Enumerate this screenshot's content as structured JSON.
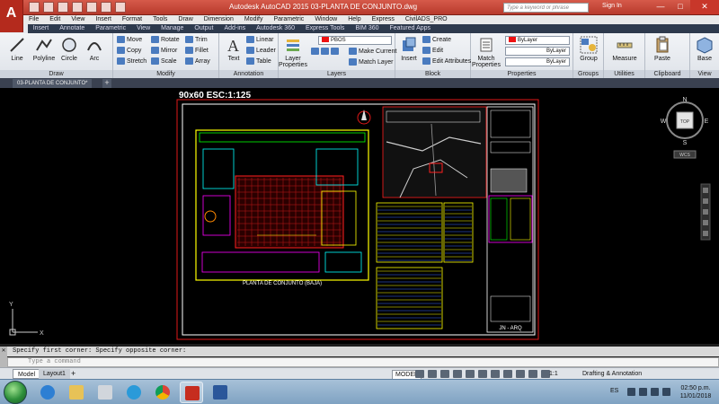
{
  "app": {
    "logo_letter": "A",
    "window_title": "Autodesk AutoCAD 2015     03-PLANTA DE CONJUNTO.dwg",
    "search_placeholder": "Type a keyword or phrase",
    "signin_label": "Sign In",
    "win_min": "—",
    "win_max": "□",
    "win_close": "✕"
  },
  "menubar": [
    "File",
    "Edit",
    "View",
    "Insert",
    "Format",
    "Tools",
    "Draw",
    "Dimension",
    "Modify",
    "Parametric",
    "Window",
    "Help",
    "Express",
    "CivilADS_PRO"
  ],
  "ribbon_tabs": [
    "Home",
    "Insert",
    "Annotate",
    "Parametric",
    "View",
    "Manage",
    "Output",
    "Add-ins",
    "Autodesk 360",
    "Express Tools",
    "BIM 360",
    "Featured Apps"
  ],
  "ribbon": {
    "draw": {
      "title": "Draw",
      "line": "Line",
      "polyline": "Polyline",
      "circle": "Circle",
      "arc": "Arc"
    },
    "modify": {
      "title": "Modify",
      "move": "Move",
      "rotate": "Rotate",
      "trim": "Trim",
      "copy": "Copy",
      "mirror": "Mirror",
      "fillet": "Fillet",
      "stretch": "Stretch",
      "scale": "Scale",
      "array": "Array"
    },
    "annotation": {
      "title": "Annotation",
      "text": "Text",
      "linear": "Linear",
      "leader": "Leader",
      "table": "Table"
    },
    "layers": {
      "title": "Layers",
      "layer_properties": "Layer Properties",
      "current_layer": "PBOS",
      "make_current": "Make Current",
      "match_layer": "Match Layer"
    },
    "block": {
      "title": "Block",
      "insert": "Insert",
      "create": "Create",
      "edit": "Edit",
      "edit_attributes": "Edit Attributes"
    },
    "properties": {
      "title": "Properties",
      "match_properties": "Match Properties",
      "color": "ByLayer",
      "linetype": "ByLayer",
      "lineweight": "ByLayer"
    },
    "groups": {
      "title": "Groups",
      "group": "Group"
    },
    "utilities": {
      "title": "Utilities",
      "measure": "Measure"
    },
    "clipboard": {
      "title": "Clipboard",
      "paste": "Paste"
    },
    "view": {
      "title": "View",
      "base": "Base"
    }
  },
  "file_tab": "03-PLANTA DE CONJUNTO*",
  "file_tab_add": "+",
  "drawing": {
    "scale_label": "90x60 ESC:1:125",
    "plan_title": "PLANTA DE CONJUNTO (BAJA)",
    "title_block_label": "JN - ARQ",
    "viewcube_top": "TOP",
    "viewcube_n": "N",
    "viewcube_s": "S",
    "viewcube_e": "E",
    "viewcube_w": "W",
    "wcs": "WCS",
    "ucs_y": "Y",
    "ucs_x": "X"
  },
  "command": {
    "history": "Specify first corner: Specify opposite corner:",
    "placeholder": "Type a command",
    "close_glyph": "✕"
  },
  "layout_tabs": {
    "model": "Model",
    "layout1": "Layout1",
    "add": "+"
  },
  "status": {
    "model": "MODEL",
    "scale": "1:1",
    "workspace": "Drafting & Annotation"
  },
  "taskbar": {
    "lang": "ES",
    "time": "02:50 p.m.",
    "date": "11/01/2018"
  },
  "colors": {
    "accent_red": "#b42a1d",
    "ribbon_dark": "#2e3a4d",
    "canvas": "#000000"
  }
}
